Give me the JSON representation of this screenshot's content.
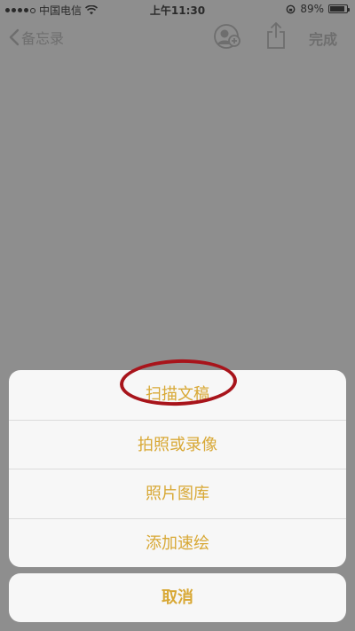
{
  "status_bar": {
    "carrier": "中国电信",
    "time": "上午11:30",
    "battery": "89%",
    "battery_level": 0.89,
    "icons": [
      "signal-icon",
      "wifi-icon",
      "rotation-lock-icon",
      "battery-icon"
    ]
  },
  "nav": {
    "back_label": "备忘录",
    "done_label": "完成",
    "icons": [
      "chevron-left-icon",
      "add-person-icon",
      "share-icon"
    ]
  },
  "action_sheet": {
    "items": [
      {
        "label": "扫描文稿"
      },
      {
        "label": "拍照或录像"
      },
      {
        "label": "照片图库"
      },
      {
        "label": "添加速绘"
      }
    ],
    "cancel_label": "取消"
  },
  "colors": {
    "accent": "#d8a835",
    "overlay": "#8e8e8e",
    "sheet": "#f7f7f7",
    "highlight": "#a8141b"
  }
}
